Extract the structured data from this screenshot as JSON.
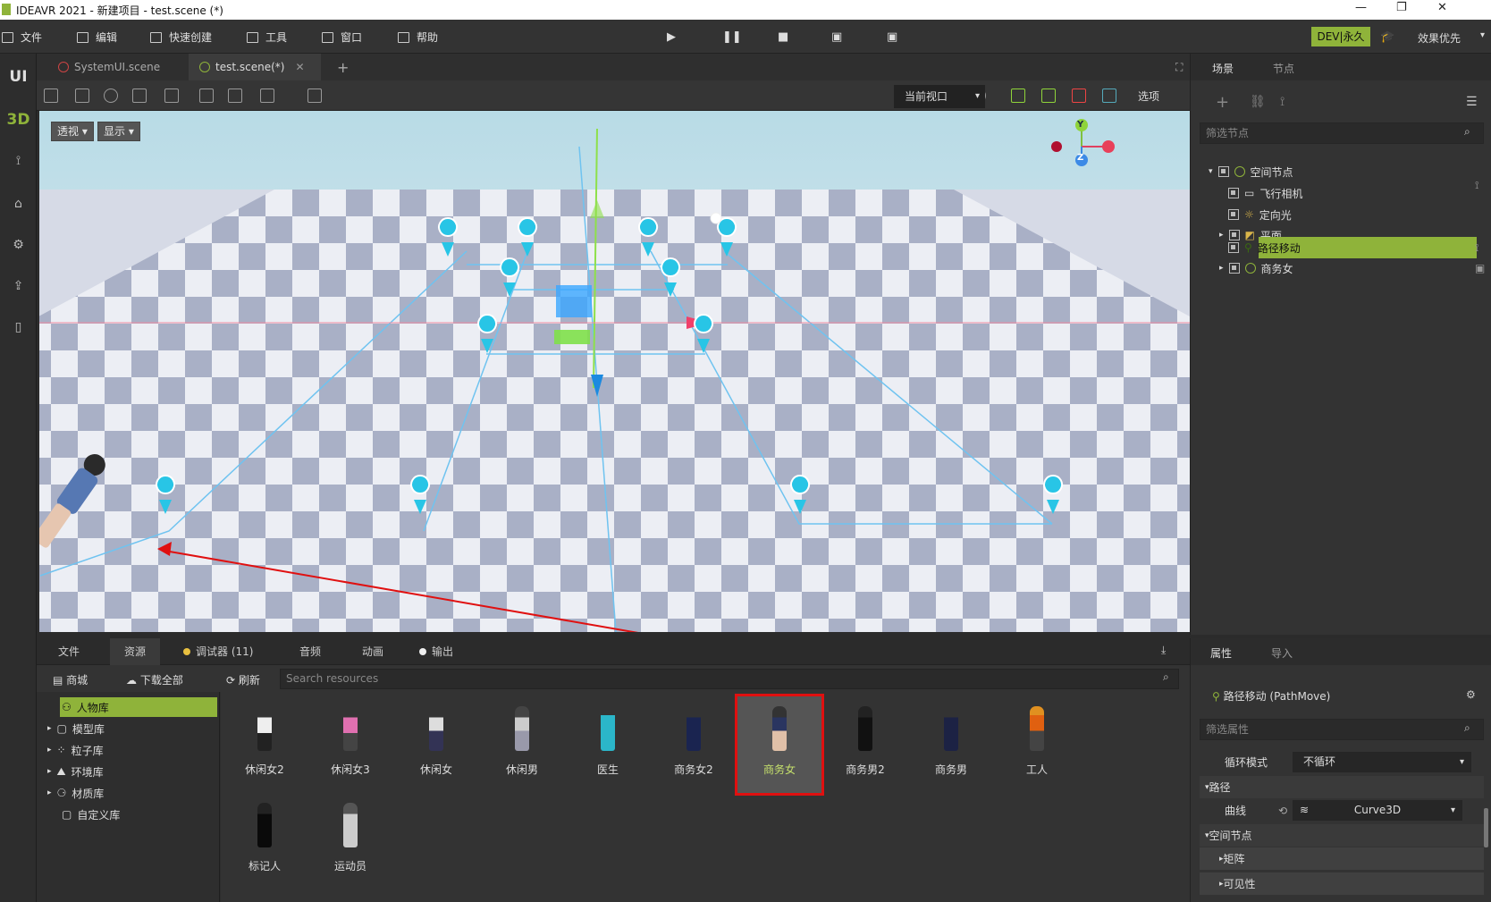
{
  "titlebar": {
    "title": "IDEAVR 2021 - 新建项目 - test.scene (*)"
  },
  "menubar": {
    "items": [
      "文件",
      "编辑",
      "快速创建",
      "工具",
      "窗口",
      "帮助"
    ],
    "dev_badge": "DEV|永久",
    "quality": "效果优先"
  },
  "leftbar": {
    "ui": "UI",
    "three_d": "3D"
  },
  "tabs": [
    {
      "label": "SystemUI.scene"
    },
    {
      "label": "test.scene(*)"
    }
  ],
  "viewport": {
    "view_select": "当前视口",
    "options_label": "选项",
    "perspective_btn": "透视",
    "display_btn": "显示",
    "axis_y": "Y",
    "axis_z": "Z"
  },
  "scene_panel": {
    "tabs": [
      "场景",
      "节点"
    ],
    "filter_placeholder": "筛选节点",
    "nodes": [
      "空间节点",
      "飞行相机",
      "定向光",
      "平面",
      "路径移动",
      "商务女"
    ]
  },
  "bottom_panel": {
    "tabs": [
      "文件",
      "资源",
      "调试器 (11)",
      "音频",
      "动画",
      "输出"
    ],
    "toolbar": {
      "shop": "商城",
      "download_all": "下载全部",
      "refresh": "刷新"
    },
    "search_placeholder": "Search resources",
    "categories": [
      "人物库",
      "模型库",
      "粒子库",
      "环境库",
      "材质库",
      "自定义库"
    ],
    "assets": [
      "休闲女2",
      "休闲女3",
      "休闲女",
      "休闲男",
      "医生",
      "商务女2",
      "商务女",
      "商务男2",
      "商务男",
      "工人",
      "标记人",
      "运动员"
    ]
  },
  "properties_panel": {
    "tabs": [
      "属性",
      "导入"
    ],
    "node_title": "路径移动 (PathMove)",
    "filter_placeholder": "筛选属性",
    "loop_mode_label": "循环模式",
    "loop_mode_value": "不循环",
    "section_path": "路径",
    "curve_label": "曲线",
    "curve_value": "Curve3D",
    "section_spatial": "空间节点",
    "sub_matrix": "矩阵",
    "sub_visibility": "可见性"
  },
  "colors": {
    "accent": "#8fb33a",
    "selection_outline": "#e01010",
    "pin": "#29c7e8"
  }
}
